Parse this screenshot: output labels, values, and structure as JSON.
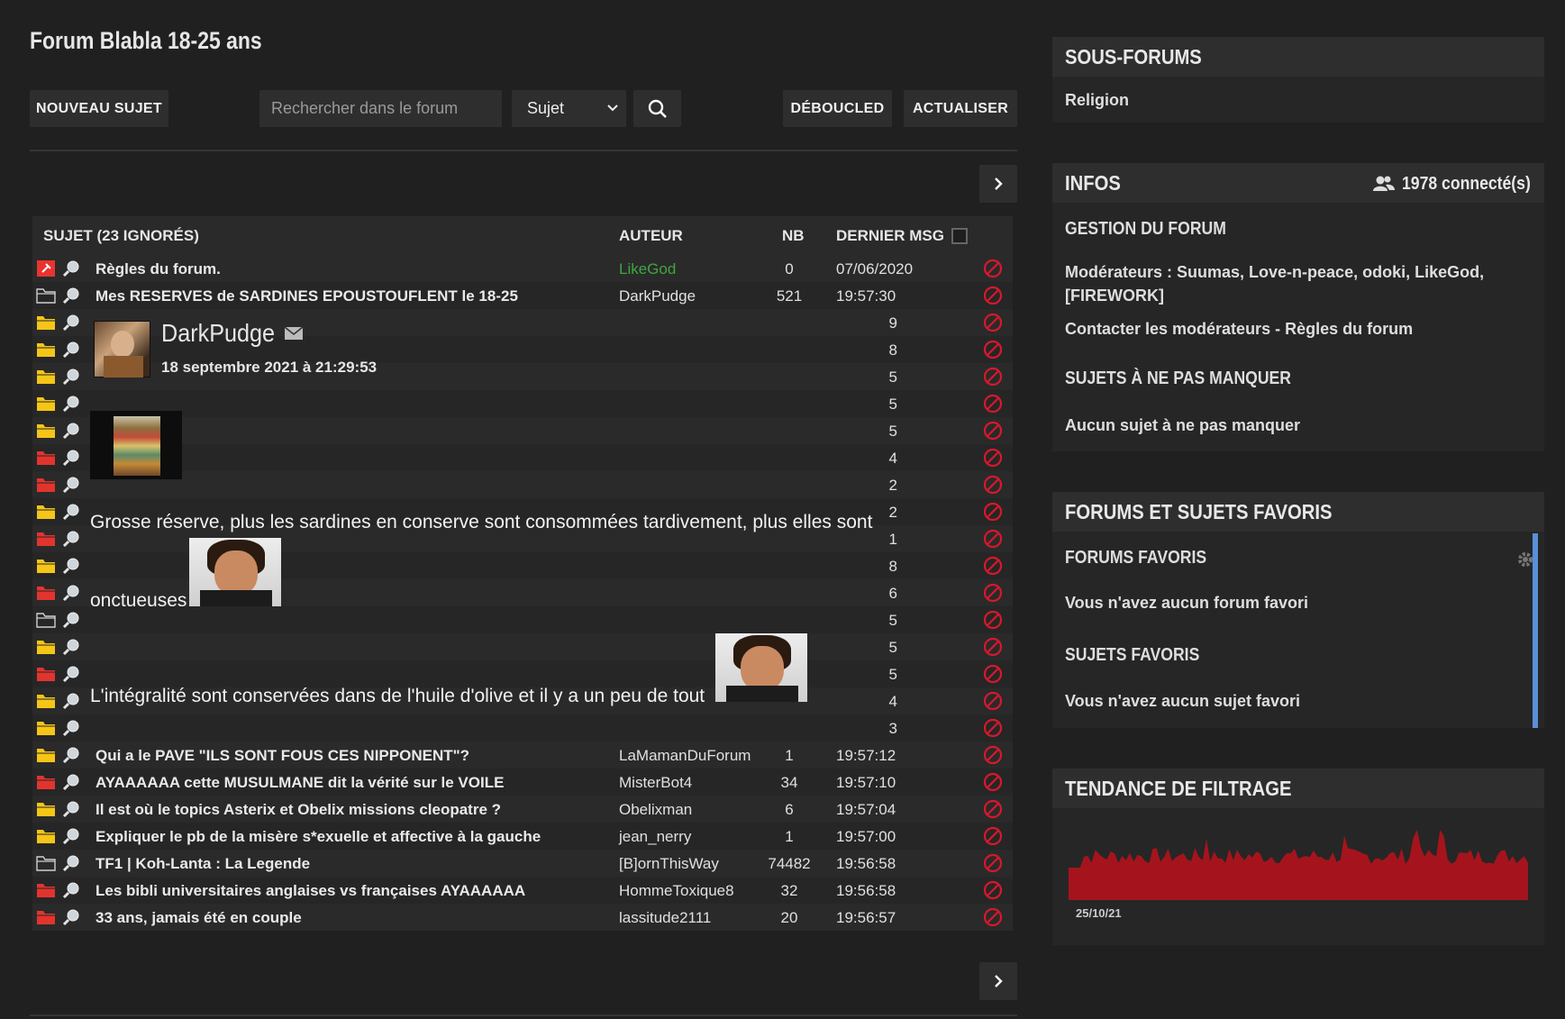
{
  "header": {
    "title": "Forum Blabla 18-25 ans",
    "new_topic": "NOUVEAU SUJET",
    "search_placeholder": "Rechercher dans le forum",
    "search_mode": "Sujet",
    "deboucled": "DÉBOUCLED",
    "refresh": "ACTUALISER"
  },
  "table": {
    "columns": {
      "subject": "SUJET (23 IGNORÉS)",
      "author": "AUTEUR",
      "nb": "NB",
      "last": "DERNIER MSG"
    },
    "rows": [
      {
        "title": "Règles du forum.",
        "author": "LikeGod",
        "nb": "0",
        "date": "07/06/2020",
        "icon": "pinned"
      },
      {
        "title": "Mes RESERVES de SARDINES EPOUSTOUFLENT le 18-25",
        "author": "DarkPudge",
        "nb": "521",
        "date": "19:57:30",
        "icon": "folder-outline"
      },
      {
        "title": "",
        "author": "",
        "nb": "9",
        "date": "",
        "icon": "folder-yellow"
      },
      {
        "title": "",
        "author": "",
        "nb": "8",
        "date": "",
        "icon": "folder-yellow"
      },
      {
        "title": "",
        "author": "",
        "nb": "5",
        "date": "",
        "icon": "folder-yellow"
      },
      {
        "title": "",
        "author": "",
        "nb": "5",
        "date": "",
        "icon": "folder-yellow"
      },
      {
        "title": "",
        "author": "",
        "nb": "5",
        "date": "",
        "icon": "folder-yellow"
      },
      {
        "title": "",
        "author": "",
        "nb": "4",
        "date": "",
        "icon": "folder-red"
      },
      {
        "title": "",
        "author": "",
        "nb": "2",
        "date": "",
        "icon": "folder-red"
      },
      {
        "title": "",
        "author": "",
        "nb": "2",
        "date": "",
        "icon": "folder-yellow"
      },
      {
        "title": "",
        "author": "",
        "nb": "1",
        "date": "",
        "icon": "folder-red"
      },
      {
        "title": "",
        "author": "",
        "nb": "8",
        "date": "",
        "icon": "folder-yellow"
      },
      {
        "title": "",
        "author": "",
        "nb": "6",
        "date": "",
        "icon": "folder-red"
      },
      {
        "title": "",
        "author": "",
        "nb": "5",
        "date": "",
        "icon": "folder-outline"
      },
      {
        "title": "",
        "author": "",
        "nb": "5",
        "date": "",
        "icon": "folder-yellow"
      },
      {
        "title": "",
        "author": "",
        "nb": "5",
        "date": "",
        "icon": "folder-red"
      },
      {
        "title": "",
        "author": "",
        "nb": "4",
        "date": "",
        "icon": "folder-yellow"
      },
      {
        "title": "",
        "author": "",
        "nb": "3",
        "date": "",
        "icon": "folder-yellow"
      },
      {
        "title": "Qui a le PAVE \"ILS SONT FOUS CES NIPPONENT\"?",
        "author": "LaMamanDuForum",
        "nb": "1",
        "date": "19:57:12",
        "icon": "folder-yellow"
      },
      {
        "title": "AYAAAAAA cette MUSULMANE dit la vérité sur le VOILE",
        "author": "MisterBot4",
        "nb": "34",
        "date": "19:57:10",
        "icon": "folder-red"
      },
      {
        "title": "Il est où le topics Asterix et Obelix missions cleopatre ?",
        "author": "Obelixman",
        "nb": "6",
        "date": "19:57:04",
        "icon": "folder-yellow"
      },
      {
        "title": "Expliquer le pb de la misère s*exuelle et affective à la gauche",
        "author": "jean_nerry",
        "nb": "1",
        "date": "19:57:00",
        "icon": "folder-yellow"
      },
      {
        "title": "TF1 | Koh-Lanta : La Legende",
        "author": "[B]ornThisWay",
        "nb": "74482",
        "date": "19:56:58",
        "icon": "folder-outline"
      },
      {
        "title": "Les bibli universitaires anglaises vs françaises AYAAAAAA",
        "author": "HommeToxique8",
        "nb": "32",
        "date": "19:56:58",
        "icon": "folder-red"
      },
      {
        "title": "33 ans, jamais été en couple",
        "author": "lassitude2111",
        "nb": "20",
        "date": "19:56:57",
        "icon": "folder-red"
      }
    ]
  },
  "popup": {
    "author": "DarkPudge",
    "date": "18 septembre 2021 à 21:29:53",
    "line1": "Grosse réserve, plus les sardines en conserve sont consommées tardivement, plus elles sont",
    "line2": "onctueuses",
    "line3": "L'intégralité sont conservées dans de l'huile d'olive et il y a un peu de tout"
  },
  "sidebar": {
    "subforums": {
      "title": "SOUS-FORUMS",
      "item": "Religion"
    },
    "infos": {
      "title": "INFOS",
      "connected": "1978 connecté(s)",
      "gestion": "GESTION DU FORUM",
      "mods_line1": "Modérateurs : Suumas, Love-n-peace, odoki, LikeGod,",
      "mods_line2": "[FIREWORK]",
      "contact": "Contacter les modérateurs",
      "separator": " - ",
      "rules": "Règles du forum",
      "must_see": "SUJETS À NE PAS MANQUER",
      "none": "Aucun sujet à ne pas manquer"
    },
    "favorites": {
      "title": "FORUMS ET SUJETS FAVORIS",
      "forums_title": "FORUMS FAVORIS",
      "forums_none": "Vous n'avez aucun forum favori",
      "topics_title": "SUJETS FAVORIS",
      "topics_none": "Vous n'avez aucun sujet favori"
    },
    "trend": {
      "title": "TENDANCE DE FILTRAGE",
      "date": "25/10/21"
    }
  },
  "colors": {
    "ban": "#d8182c",
    "folder_yellow": "#f5c518",
    "folder_red": "#e2342f",
    "pin": "#e8342f",
    "trend": "#a5141c",
    "link_green": "#3fa63f"
  }
}
